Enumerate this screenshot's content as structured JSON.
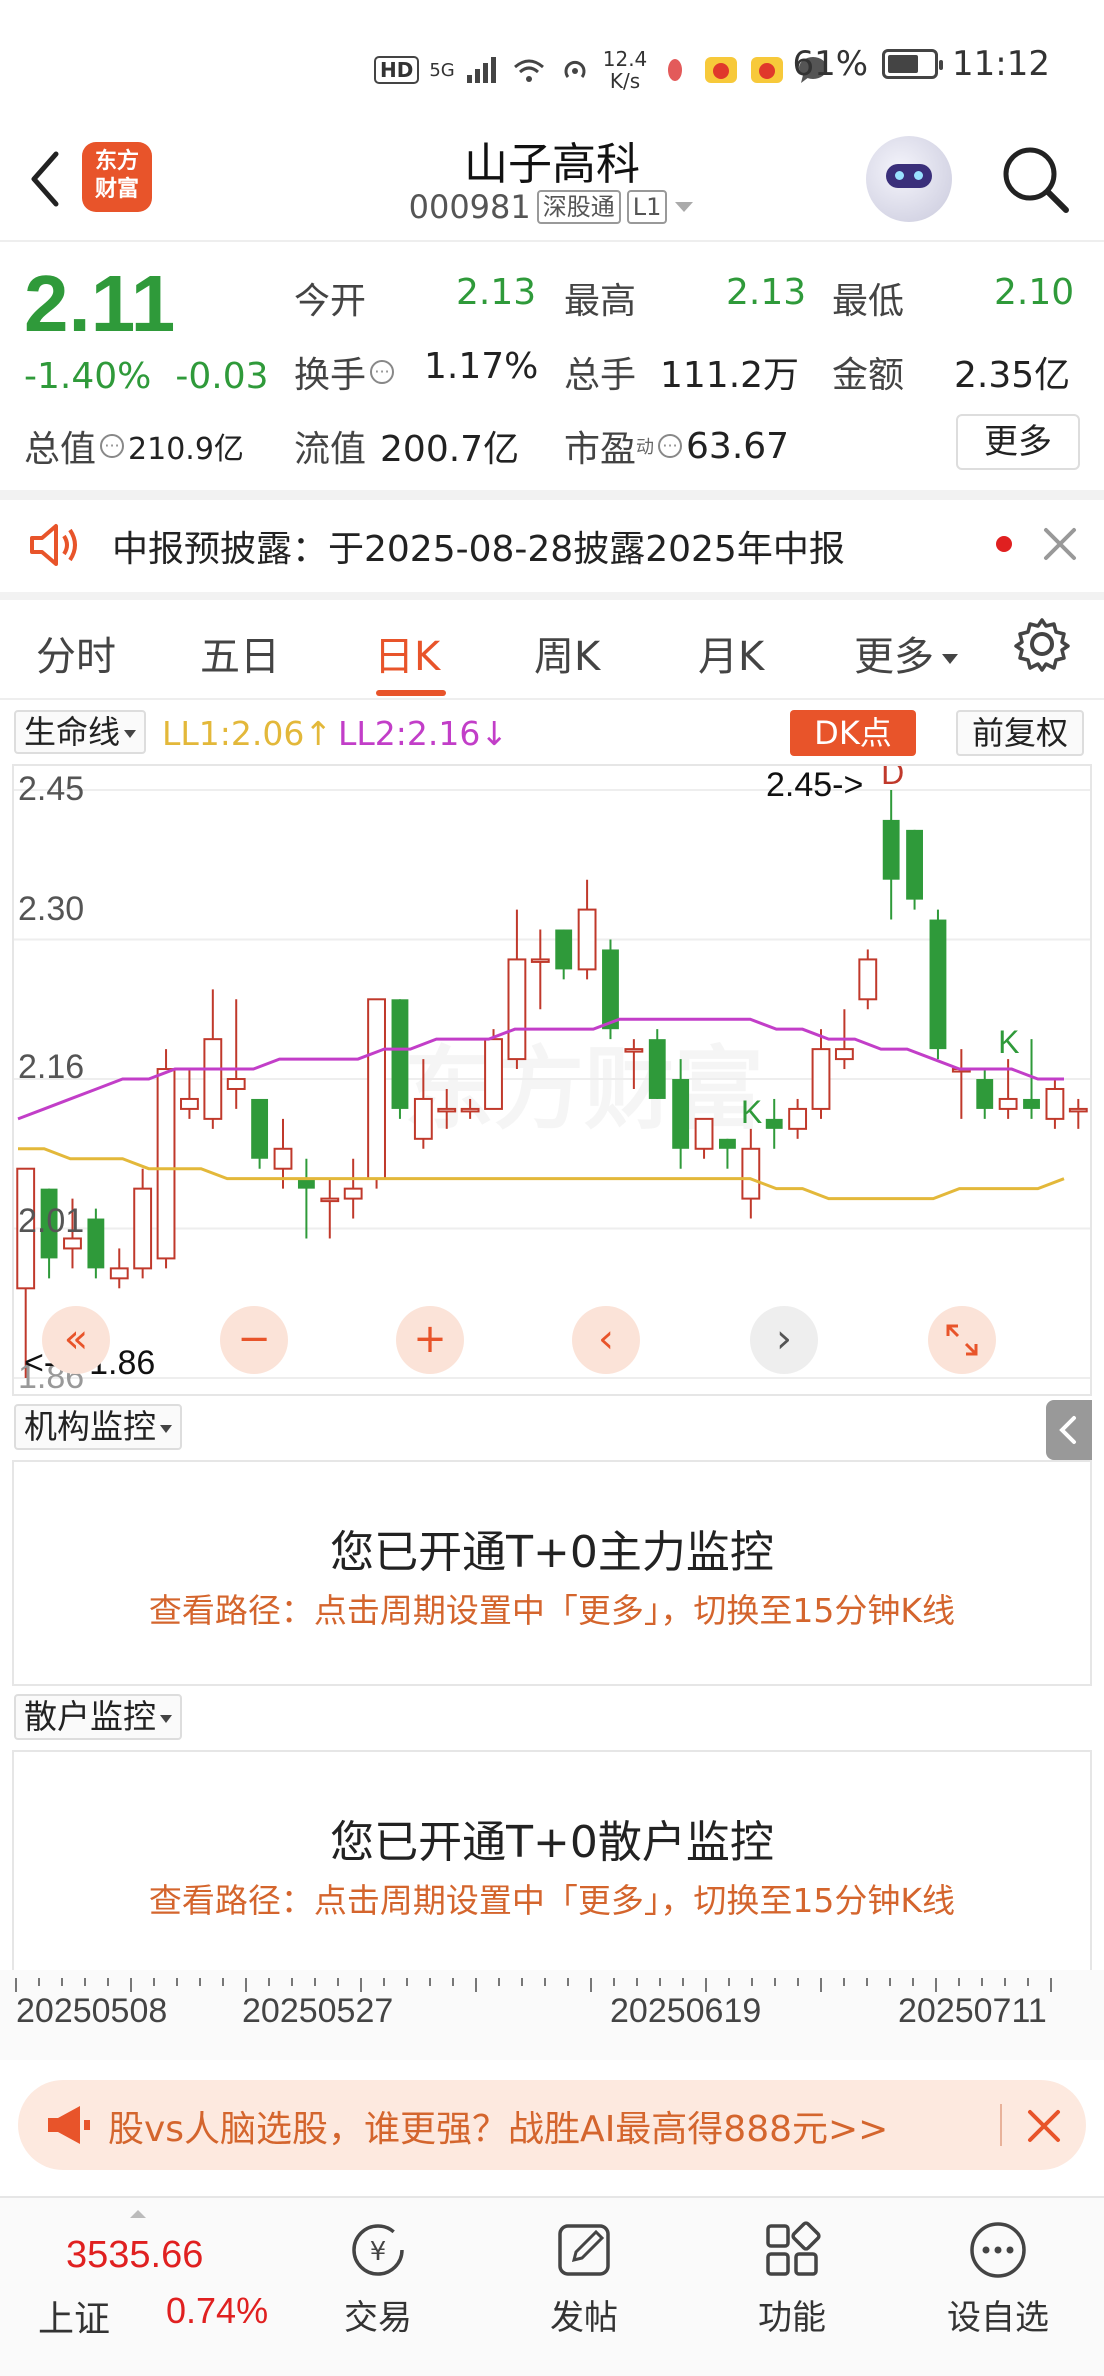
{
  "statusbar": {
    "hd": "HD",
    "net": "5G",
    "speed_value": "12.4",
    "speed_unit": "K/s",
    "battery": "61%",
    "time": "11:12"
  },
  "header": {
    "logo_line1": "东方",
    "logo_line2": "财富",
    "stock_name": "山子高科",
    "stock_code": "000981",
    "tag1": "深股通",
    "tag2": "L1"
  },
  "quote": {
    "price": "2.11",
    "change_pct": "-1.40%",
    "change_abs": "-0.03",
    "open_label": "今开",
    "open": "2.13",
    "high_label": "最高",
    "high": "2.13",
    "low_label": "最低",
    "low": "2.10",
    "turnover_label": "换手",
    "turnover": "1.17%",
    "volume_label": "总手",
    "volume": "111.2万",
    "amount_label": "金额",
    "amount": "2.35亿",
    "mcap_label": "总值",
    "mcap": "210.9亿",
    "float_label": "流值",
    "float": "200.7亿",
    "pe_label": "市盈",
    "pe_sup": "动",
    "pe": "63.67",
    "more": "更多"
  },
  "announcement": {
    "text": "中报预披露：于2025-08-28披露2025年中报"
  },
  "tabs": [
    "分时",
    "五日",
    "日K",
    "周K",
    "月K",
    "更多"
  ],
  "active_tab": "日K",
  "chart_header": {
    "indicator": "生命线",
    "ll1": "LL1:2.06↑",
    "ll2": "LL2:2.16↓",
    "dk": "DK点",
    "adjust": "前复权"
  },
  "chart_labels": {
    "high_marker": "2.45->",
    "low_marker": "<----1.86",
    "signal_k": "K",
    "signal_d": "D",
    "watermark": "东方财富"
  },
  "chart_data": {
    "type": "candlestick",
    "ylim": [
      1.86,
      2.45
    ],
    "yticks": [
      "2.45",
      "2.30",
      "2.16",
      "2.01",
      "1.86"
    ],
    "candles": [
      {
        "o": 1.95,
        "c": 2.07,
        "h": 2.07,
        "l": 1.86
      },
      {
        "o": 2.05,
        "c": 1.98,
        "h": 2.05,
        "l": 1.96
      },
      {
        "o": 1.99,
        "c": 2.0,
        "h": 2.04,
        "l": 1.97
      },
      {
        "o": 2.02,
        "c": 1.97,
        "h": 2.03,
        "l": 1.96
      },
      {
        "o": 1.96,
        "c": 1.97,
        "h": 1.99,
        "l": 1.95
      },
      {
        "o": 1.97,
        "c": 2.05,
        "h": 2.07,
        "l": 1.96
      },
      {
        "o": 1.98,
        "c": 2.17,
        "h": 2.19,
        "l": 1.97
      },
      {
        "o": 2.13,
        "c": 2.14,
        "h": 2.17,
        "l": 2.12
      },
      {
        "o": 2.12,
        "c": 2.2,
        "h": 2.25,
        "l": 2.11
      },
      {
        "o": 2.15,
        "c": 2.16,
        "h": 2.24,
        "l": 2.13
      },
      {
        "o": 2.14,
        "c": 2.08,
        "h": 2.14,
        "l": 2.07
      },
      {
        "o": 2.07,
        "c": 2.09,
        "h": 2.12,
        "l": 2.05
      },
      {
        "o": 2.06,
        "c": 2.05,
        "h": 2.08,
        "l": 2.0
      },
      {
        "o": 2.04,
        "c": 2.04,
        "h": 2.06,
        "l": 2.0
      },
      {
        "o": 2.04,
        "c": 2.05,
        "h": 2.08,
        "l": 2.02
      },
      {
        "o": 2.06,
        "c": 2.24,
        "h": 2.24,
        "l": 2.05
      },
      {
        "o": 2.24,
        "c": 2.13,
        "h": 2.24,
        "l": 2.12
      },
      {
        "o": 2.1,
        "c": 2.14,
        "h": 2.18,
        "l": 2.09
      },
      {
        "o": 2.13,
        "c": 2.13,
        "h": 2.15,
        "l": 2.11
      },
      {
        "o": 2.13,
        "c": 2.13,
        "h": 2.14,
        "l": 2.12
      },
      {
        "o": 2.13,
        "c": 2.2,
        "h": 2.21,
        "l": 2.13
      },
      {
        "o": 2.18,
        "c": 2.28,
        "h": 2.33,
        "l": 2.17
      },
      {
        "o": 2.28,
        "c": 2.28,
        "h": 2.31,
        "l": 2.23
      },
      {
        "o": 2.31,
        "c": 2.27,
        "h": 2.31,
        "l": 2.26
      },
      {
        "o": 2.27,
        "c": 2.33,
        "h": 2.36,
        "l": 2.26
      },
      {
        "o": 2.29,
        "c": 2.21,
        "h": 2.3,
        "l": 2.2
      },
      {
        "o": 2.19,
        "c": 2.19,
        "h": 2.2,
        "l": 2.15
      },
      {
        "o": 2.2,
        "c": 2.14,
        "h": 2.21,
        "l": 2.14
      },
      {
        "o": 2.16,
        "c": 2.09,
        "h": 2.18,
        "l": 2.07
      },
      {
        "o": 2.09,
        "c": 2.12,
        "h": 2.12,
        "l": 2.08
      },
      {
        "o": 2.1,
        "c": 2.09,
        "h": 2.1,
        "l": 2.07
      },
      {
        "o": 2.04,
        "c": 2.09,
        "h": 2.11,
        "l": 2.02
      },
      {
        "o": 2.12,
        "c": 2.11,
        "h": 2.14,
        "l": 2.09
      },
      {
        "o": 2.11,
        "c": 2.13,
        "h": 2.14,
        "l": 2.1
      },
      {
        "o": 2.13,
        "c": 2.19,
        "h": 2.21,
        "l": 2.12
      },
      {
        "o": 2.18,
        "c": 2.19,
        "h": 2.23,
        "l": 2.17
      },
      {
        "o": 2.24,
        "c": 2.28,
        "h": 2.29,
        "l": 2.23
      },
      {
        "o": 2.42,
        "c": 2.36,
        "h": 2.45,
        "l": 2.32
      },
      {
        "o": 2.41,
        "c": 2.34,
        "h": 2.41,
        "l": 2.33
      },
      {
        "o": 2.32,
        "c": 2.19,
        "h": 2.33,
        "l": 2.18
      },
      {
        "o": 2.17,
        "c": 2.17,
        "h": 2.19,
        "l": 2.12
      },
      {
        "o": 2.16,
        "c": 2.13,
        "h": 2.17,
        "l": 2.12
      },
      {
        "o": 2.13,
        "c": 2.14,
        "h": 2.18,
        "l": 2.12
      },
      {
        "o": 2.14,
        "c": 2.13,
        "h": 2.2,
        "l": 2.12
      },
      {
        "o": 2.12,
        "c": 2.15,
        "h": 2.16,
        "l": 2.11
      },
      {
        "o": 2.13,
        "c": 2.13,
        "h": 2.14,
        "l": 2.11
      }
    ],
    "ll2_line": [
      2.12,
      2.13,
      2.14,
      2.15,
      2.16,
      2.16,
      2.17,
      2.17,
      2.17,
      2.17,
      2.18,
      2.18,
      2.18,
      2.18,
      2.19,
      2.19,
      2.2,
      2.2,
      2.2,
      2.21,
      2.21,
      2.21,
      2.21,
      2.22,
      2.22,
      2.22,
      2.22,
      2.22,
      2.22,
      2.21,
      2.21,
      2.2,
      2.2,
      2.19,
      2.19,
      2.18,
      2.17,
      2.17,
      2.17,
      2.16,
      2.16
    ],
    "ll1_line": [
      2.09,
      2.09,
      2.08,
      2.08,
      2.08,
      2.07,
      2.07,
      2.07,
      2.06,
      2.06,
      2.06,
      2.06,
      2.06,
      2.06,
      2.06,
      2.06,
      2.06,
      2.06,
      2.06,
      2.06,
      2.06,
      2.06,
      2.06,
      2.06,
      2.06,
      2.06,
      2.06,
      2.06,
      2.06,
      2.05,
      2.05,
      2.04,
      2.04,
      2.04,
      2.04,
      2.04,
      2.05,
      2.05,
      2.05,
      2.05,
      2.06
    ],
    "signals": [
      {
        "index": 31,
        "label": "K",
        "color": "#2f9a3a"
      },
      {
        "index": 37,
        "label": "D",
        "color": "#c0392b"
      },
      {
        "index": 42,
        "label": "K",
        "color": "#2f9a3a"
      }
    ],
    "colors": {
      "up": "#c0392b",
      "down": "#2f9a3a",
      "ll1": "#e3b83a",
      "ll2": "#c23ec8"
    }
  },
  "monitors": [
    {
      "select": "机构监控",
      "title": "您已开通T+0主力监控",
      "path": "查看路径：点击周期设置中「更多」，切换至15分钟K线"
    },
    {
      "select": "散户监控",
      "title": "您已开通T+0散户监控",
      "path": "查看路径：点击周期设置中「更多」，切换至15分钟K线"
    }
  ],
  "dates": [
    "20250508",
    "20250527",
    "20250619",
    "20250711"
  ],
  "ad": {
    "text": "股vs人脑选股，谁更强？战胜AI最高得888元>>"
  },
  "bottombar": {
    "index_value": "3535.66",
    "index_name": "上证",
    "index_change": "0.74%",
    "nav": [
      "交易",
      "发帖",
      "功能",
      "设自选"
    ]
  }
}
